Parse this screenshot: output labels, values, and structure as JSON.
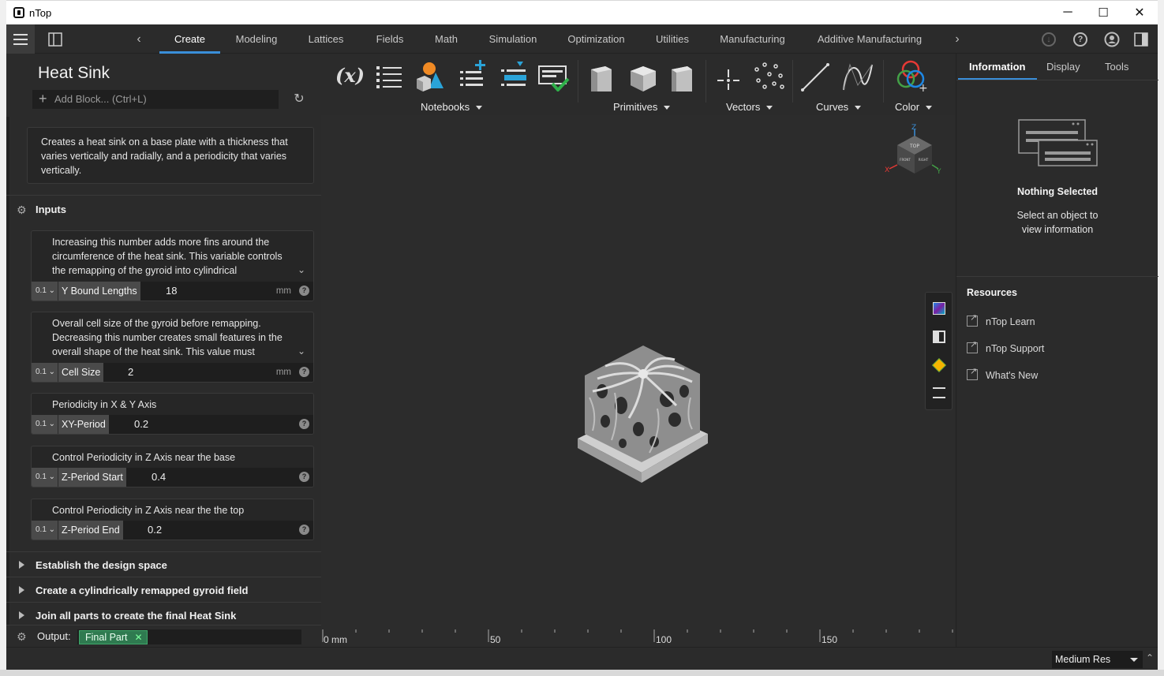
{
  "window": {
    "title": "nTop",
    "minimize": "─",
    "maximize": "☐",
    "close": "✕"
  },
  "header": {
    "tabs": [
      "Create",
      "Modeling",
      "Lattices",
      "Fields",
      "Math",
      "Simulation",
      "Optimization",
      "Utilities",
      "Manufacturing",
      "Additive Manufacturing"
    ],
    "active_tab": "Create",
    "help_icon": "?"
  },
  "notebook": {
    "title": "Heat Sink",
    "add_block_placeholder": "Add Block... (Ctrl+L)",
    "description": "Creates a heat sink on a base plate with a thickness that varies vertically and radially, and a periodicity that varies vertically.",
    "inputs_label": "Inputs",
    "inputs": [
      {
        "description": "Increasing this number adds more fins around the circumference of the heat sink. This variable controls the remapping of the gyroid into cylindrical",
        "type": "0.1",
        "name": "Y Bound Lengths",
        "value": "18",
        "unit": "mm"
      },
      {
        "description": "Overall cell size of the gyroid before remapping. Decreasing this number creates small features in the overall shape of the heat sink. This value must",
        "type": "0.1",
        "name": "Cell Size",
        "value": "2",
        "unit": "mm"
      },
      {
        "description": "Periodicity in X & Y Axis",
        "type": "0.1",
        "name": "XY-Period",
        "value": "0.2",
        "unit": ""
      },
      {
        "description": "Control Periodicity in Z Axis near the base",
        "type": "0.1",
        "name": "Z-Period Start",
        "value": "0.4",
        "unit": ""
      },
      {
        "description": "Control Periodicity in Z Axis near the the top",
        "type": "0.1",
        "name": "Z-Period End",
        "value": "0.2",
        "unit": ""
      }
    ],
    "sections": [
      "Establish the design space",
      "Create a cylindrically remapped gyroid field",
      "Join all parts to create the final Heat Sink"
    ],
    "output_label": "Output:",
    "output_value": "Final Part"
  },
  "ribbon": {
    "groups": [
      "Notebooks",
      "Primitives",
      "Vectors",
      "Curves",
      "Color"
    ]
  },
  "viewport": {
    "ruler_labels": [
      "0 mm",
      "50",
      "100",
      "150"
    ],
    "cube": {
      "top": "TOP",
      "left": "FRONT",
      "right": "RIGHT",
      "axes": [
        "Z",
        "X",
        "Y"
      ]
    }
  },
  "right_panel": {
    "tabs": [
      "Information",
      "Display",
      "Tools"
    ],
    "active_tab": "Information",
    "nothing_title": "Nothing Selected",
    "nothing_text": "Select an object to view information",
    "resources_title": "Resources",
    "resources": [
      "nTop Learn",
      "nTop Support",
      "What's New"
    ]
  },
  "status": {
    "resolution": "Medium Res"
  },
  "colors": {
    "accent": "#3a8fd9",
    "output_chip": "#2f7a50",
    "bg_panel": "#2b2b2b",
    "viewport": "#2c2c2c"
  }
}
